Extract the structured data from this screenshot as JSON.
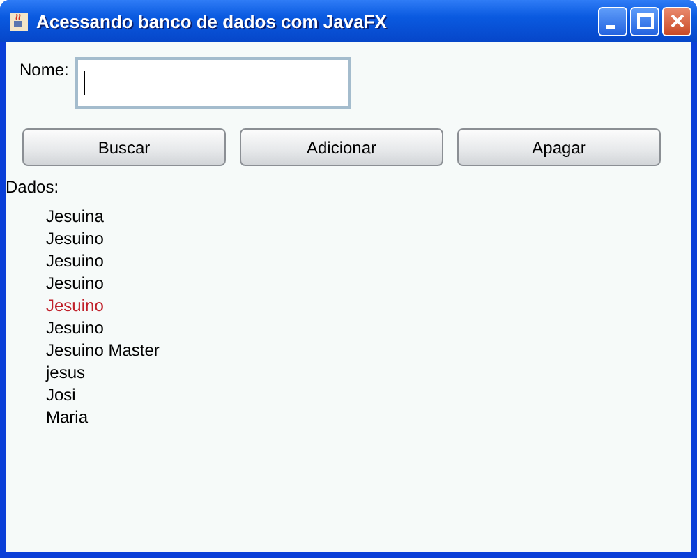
{
  "window": {
    "title": "Acessando banco de dados com JavaFX"
  },
  "form": {
    "label": "Nome:"
  },
  "buttons": [
    "Buscar",
    "Adicionar",
    "Apagar"
  ],
  "list": {
    "label": "Dados:",
    "items": [
      {
        "text": "Jesuina",
        "selected": false
      },
      {
        "text": "Jesuino",
        "selected": false
      },
      {
        "text": "Jesuino",
        "selected": false
      },
      {
        "text": "Jesuino",
        "selected": false
      },
      {
        "text": "Jesuino",
        "selected": true
      },
      {
        "text": "Jesuino",
        "selected": false
      },
      {
        "text": "Jesuino Master",
        "selected": false
      },
      {
        "text": "jesus",
        "selected": false
      },
      {
        "text": "Josi",
        "selected": false
      },
      {
        "text": "Maria",
        "selected": false
      }
    ]
  }
}
